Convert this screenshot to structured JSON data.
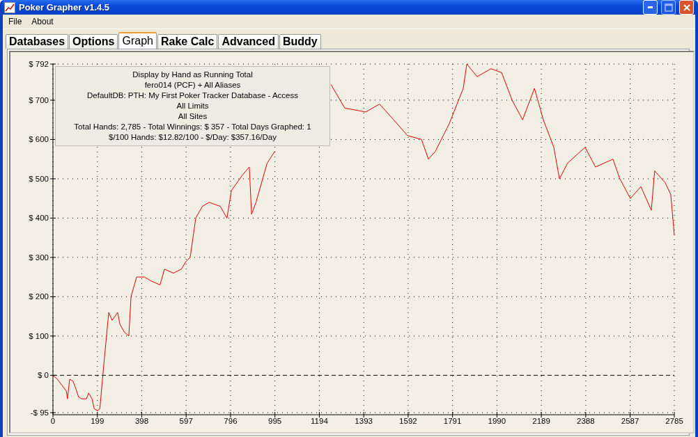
{
  "window": {
    "title": "Poker Grapher v1.4.5"
  },
  "menu": [
    "File",
    "About"
  ],
  "tabs": [
    {
      "label": "Databases",
      "selected": false
    },
    {
      "label": "Options",
      "selected": false
    },
    {
      "label": "Graph",
      "selected": true
    },
    {
      "label": "Rake Calc",
      "selected": false
    },
    {
      "label": "Advanced",
      "selected": false
    },
    {
      "label": "Buddy",
      "selected": false
    }
  ],
  "info_box": [
    "Display by Hand as Running Total",
    "fero014 (PCF) + All Aliases",
    "DefaultDB: PTH: My First Poker Tracker Database - Access",
    "All Limits",
    "All Sites",
    "Total Hands: 2,785 - Total Winnings: $ 357 - Total Days Graphed: 1",
    "$/100 Hands: $12.82/100 - $/Day: $357.16/Day"
  ],
  "chart_data": {
    "type": "line",
    "grid": true,
    "ylim": [
      -95,
      792
    ],
    "xlim": [
      0,
      2785
    ],
    "yticks": [
      {
        "value": -95,
        "label": "-$ 95"
      },
      {
        "value": 0,
        "label": "$ 0"
      },
      {
        "value": 100,
        "label": "$ 100"
      },
      {
        "value": 200,
        "label": "$ 200"
      },
      {
        "value": 300,
        "label": "$ 300"
      },
      {
        "value": 400,
        "label": "$ 400"
      },
      {
        "value": 500,
        "label": "$ 500"
      },
      {
        "value": 600,
        "label": "$ 600"
      },
      {
        "value": 700,
        "label": "$ 700"
      },
      {
        "value": 792,
        "label": "$ 792"
      }
    ],
    "xticks": [
      0,
      199,
      398,
      597,
      796,
      995,
      1194,
      1393,
      1592,
      1791,
      1990,
      2189,
      2388,
      2587,
      2785
    ],
    "x": [
      0,
      20,
      40,
      60,
      65,
      75,
      90,
      100,
      115,
      130,
      150,
      160,
      175,
      185,
      200,
      210,
      230,
      250,
      265,
      290,
      300,
      320,
      340,
      350,
      375,
      410,
      440,
      480,
      500,
      540,
      575,
      597,
      615,
      640,
      670,
      700,
      750,
      780,
      800,
      850,
      880,
      890,
      910,
      940,
      960,
      995,
      1246,
      1308,
      1402,
      1464,
      1527,
      1589,
      1652,
      1683,
      1714,
      1776,
      1839,
      1855,
      1901,
      1964,
      2011,
      2058,
      2105,
      2158,
      2198,
      2245,
      2270,
      2307,
      2385,
      2432,
      2510,
      2541,
      2588,
      2635,
      2682,
      2697,
      2744,
      2769,
      2785
    ],
    "series": [
      {
        "color": "#e00000",
        "values": [
          0,
          -10,
          -25,
          -40,
          -60,
          -10,
          -15,
          -30,
          -55,
          -60,
          -60,
          -45,
          -60,
          -85,
          -90,
          -85,
          40,
          160,
          140,
          160,
          130,
          110,
          100,
          200,
          250,
          250,
          240,
          230,
          270,
          260,
          270,
          290,
          300,
          400,
          430,
          440,
          430,
          400,
          470,
          510,
          530,
          410,
          440,
          500,
          540,
          570,
          740,
          680,
          670,
          690,
          650,
          610,
          600,
          550,
          570,
          640,
          730,
          792,
          760,
          780,
          770,
          700,
          650,
          730,
          650,
          580,
          500,
          540,
          580,
          530,
          550,
          500,
          450,
          480,
          420,
          520,
          490,
          460,
          357
        ]
      }
    ]
  }
}
